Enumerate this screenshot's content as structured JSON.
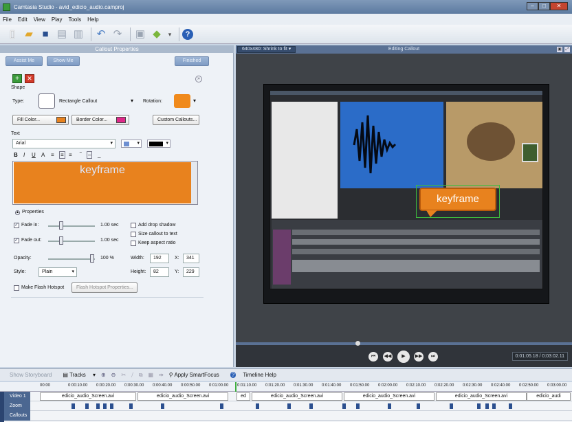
{
  "window": {
    "title": "Camtasia Studio - avid_edicio_audio.camproj"
  },
  "window_controls": {
    "minimize": "–",
    "maximize": "□",
    "close": "✕"
  },
  "menu": [
    "File",
    "Edit",
    "View",
    "Play",
    "Tools",
    "Help"
  ],
  "callout_panel": {
    "title": "Callout Properties",
    "assist_label": "Assist Me",
    "show_me_label": "Show Me",
    "finished_label": "Finished",
    "shape_label": "Shape",
    "type_label": "Type:",
    "type_value": "Rectangle Callout",
    "rotation_label": "Rotation:",
    "fill_color_label": "Fill Color...",
    "border_color_label": "Border Color...",
    "custom_callouts_label": "Custom Callouts...",
    "text_label": "Text",
    "font_value": "Arial",
    "callout_text": "keyframe",
    "properties_label": "Properties",
    "fade_in_label": "Fade in:",
    "fade_in_value": "1.00 sec",
    "fade_out_label": "Fade out:",
    "fade_out_value": "1.00 sec",
    "opacity_label": "Opacity:",
    "opacity_value": "100 %",
    "style_label": "Style:",
    "style_value": "Plain",
    "drop_shadow_label": "Add drop shadow",
    "size_callout_label": "Size callout to text",
    "keep_aspect_label": "Keep aspect ratio",
    "width_label": "Width:",
    "width_value": "192",
    "height_label": "Height:",
    "height_value": "82",
    "x_label": "X:",
    "x_value": "341",
    "y_label": "Y:",
    "y_value": "229",
    "flash_hotspot_label": "Make Flash Hotspot",
    "flash_hotspot_props_label": "Flash Hotspot Properties...",
    "fill_color": "#e8821e",
    "border_color": "#e0288a",
    "font_color": "#000000",
    "rotation_color": "#f08a1c"
  },
  "preview": {
    "size_label": "640x480: Shrink to fit",
    "editing_label": "Editing Callout",
    "callout_text": "keyframe",
    "time_display": "0:01:05.18 / 0:03:02.11"
  },
  "timeline": {
    "show_storyboard": "Show Storyboard",
    "tracks_label": "Tracks",
    "apply_smartfocus": "Apply SmartFocus",
    "timeline_help": "Timeline Help",
    "ticks": [
      "00:00",
      "0:00:10.00",
      "0:00:20.00",
      "0:00:30.00",
      "0:00:40.00",
      "0:00:50.00",
      "0:01:00.00",
      "0:01:10.00",
      "0:01:20.00",
      "0:01:30.00",
      "0:01:40.00",
      "0:01:50.00",
      "0:02:00.00",
      "0:02:10.00",
      "0:02:20.00",
      "0:02:30.00",
      "0:02:40.00",
      "0:02:50.00",
      "0:03:00.00"
    ],
    "track_video": "Video 1",
    "track_zoom": "Zoom",
    "track_callouts": "Callouts",
    "clips": [
      "edicio_audio_Screen.avi",
      "edicio_audio_Screen.avi",
      "ed",
      "edicio_audio_Screen.avi",
      "edicio_audio_Screen.avi",
      "edicio_audio_Screen.avi",
      "edicio_audi"
    ]
  }
}
